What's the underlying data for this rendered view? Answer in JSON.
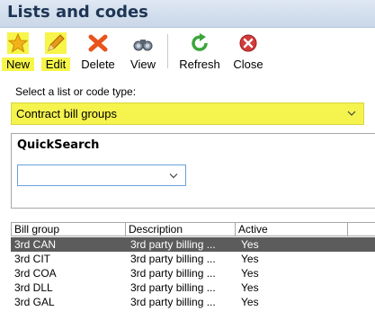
{
  "window": {
    "title": "Lists and codes"
  },
  "toolbar": {
    "new_label": "New",
    "edit_label": "Edit",
    "delete_label": "Delete",
    "view_label": "View",
    "refresh_label": "Refresh",
    "close_label": "Close"
  },
  "list_type": {
    "label": "Select a list or code type:",
    "selected": "Contract bill groups"
  },
  "quicksearch": {
    "title": "QuickSearch",
    "value": ""
  },
  "grid": {
    "columns": [
      "Bill group",
      "Description",
      "Active"
    ],
    "rows": [
      [
        "3rd CAN",
        "3rd party billing ...",
        "Yes"
      ],
      [
        "3rd CIT",
        "3rd party billing ...",
        "Yes"
      ],
      [
        "3rd COA",
        "3rd party billing ...",
        "Yes"
      ],
      [
        "3rd DLL",
        "3rd party billing ...",
        "Yes"
      ],
      [
        "3rd GAL",
        "3rd party billing ...",
        "Yes"
      ]
    ]
  },
  "colors": {
    "highlight": "#f7f54a",
    "title_text": "#1e3555",
    "selected_row": "#5c5c5c"
  },
  "icons": [
    "star-icon",
    "pencil-icon",
    "delete-x-icon",
    "binoculars-icon",
    "refresh-icon",
    "close-icon",
    "chevron-down-icon"
  ]
}
